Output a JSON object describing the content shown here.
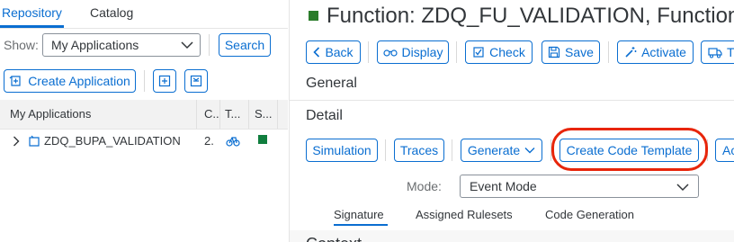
{
  "left_panel": {
    "tabs": [
      {
        "label": "Repository",
        "active": true
      },
      {
        "label": "Catalog",
        "active": false
      }
    ],
    "show_label": "Show:",
    "show_select_value": "My Applications",
    "search_button": "Search",
    "create_application_button": "Create Application",
    "columns": [
      "My Applications",
      "C..",
      "T...",
      "S..."
    ],
    "rows": [
      {
        "name": "ZDQ_BUPA_VALIDATION",
        "c": "2.",
        "type_icon": "cycle-icon",
        "status_color": "#107e3e"
      }
    ]
  },
  "right_panel": {
    "title": "Function: ZDQ_FU_VALIDATION, Function",
    "status_color": "#2b7c2b",
    "toolbar": {
      "back": "Back",
      "display": "Display",
      "check": "Check",
      "save": "Save",
      "activate": "Activate",
      "overflow": "Tr"
    },
    "section_general": "General",
    "section_detail": "Detail",
    "detail_toolbar": {
      "simulation": "Simulation",
      "traces": "Traces",
      "generate": "Generate",
      "create_code_template": "Create Code Template",
      "overflow": "Ac"
    },
    "mode_label": "Mode:",
    "mode_value": "Event Mode",
    "tabs": [
      {
        "label": "Signature",
        "active": true
      },
      {
        "label": "Assigned Rulesets",
        "active": false
      },
      {
        "label": "Code Generation",
        "active": false
      }
    ],
    "bottom_cutoff_text": "Context"
  },
  "colors": {
    "accent": "#0a6ed1",
    "highlight_circle": "#e8250a",
    "status_green": "#107e3e"
  }
}
